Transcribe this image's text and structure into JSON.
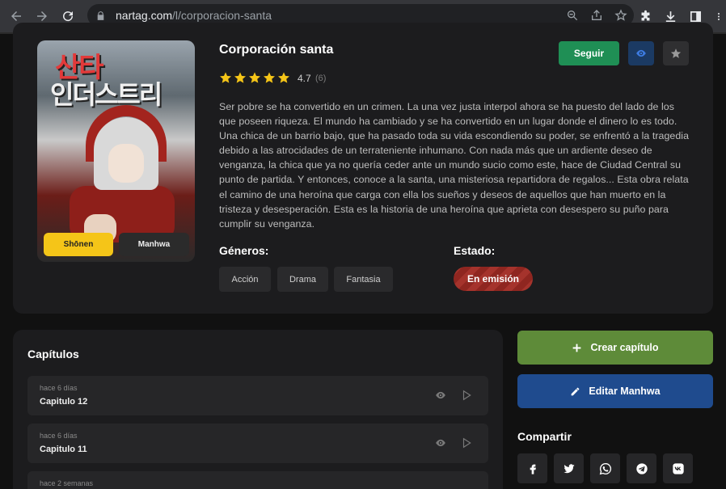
{
  "browser": {
    "url_domain": "nartag.com",
    "url_path": "/l/corporacion-santa"
  },
  "manga": {
    "title": "Corporación santa",
    "rating": "4.7",
    "rating_count": "(6)",
    "stars_filled": 5,
    "cover_title_line1": "산타",
    "cover_title_line2": "인더스트리",
    "tag_genre": "Shōnen",
    "tag_type": "Manhwa",
    "synopsis": "Ser pobre se ha convertido en un crimen. La una vez justa interpol ahora se ha puesto del lado de los que poseen riqueza. El mundo ha cambiado y se ha convertido en un lugar donde el dinero lo es todo. Una chica de un barrio bajo, que ha pasado toda su vida escondiendo su poder, se enfrentó a la tragedia debido a las atrocidades de un terrateniente inhumano. Con nada más que un ardiente deseo de venganza, la chica que ya no quería ceder ante un mundo sucio como este, hace de Ciudad Central su punto de partida. Y entonces, conoce a la santa, una misteriosa repartidora de regalos... Esta obra relata el camino de una heroína que carga con ella los sueños y deseos de aquellos que han muerto en la tristeza y desesperación. Esta es la historia de una heroína que aprieta con desespero su puño para cumplir su venganza."
  },
  "actions": {
    "follow_label": "Seguir"
  },
  "genres": {
    "label": "Géneros:",
    "items": [
      "Acción",
      "Drama",
      "Fantasia"
    ]
  },
  "status": {
    "label": "Estado:",
    "value": "En emisión"
  },
  "chapters": {
    "title": "Capítulos",
    "items": [
      {
        "time": "hace 6 días",
        "name": "Capitulo 12"
      },
      {
        "time": "hace 6 días",
        "name": "Capitulo 11"
      },
      {
        "time": "hace 2 semanas",
        "name": ""
      }
    ]
  },
  "sidebar": {
    "create_chapter": "Crear capítulo",
    "edit_manhwa": "Editar Manhwa",
    "share_title": "Compartir",
    "share_icons": [
      "facebook-icon",
      "twitter-icon",
      "whatsapp-icon",
      "telegram-icon",
      "vk-icon"
    ]
  },
  "colors": {
    "follow": "#1f8f55",
    "create": "#5e8b39",
    "edit": "#1f4b8e",
    "status": "#a5332c",
    "star": "#f5c518"
  }
}
